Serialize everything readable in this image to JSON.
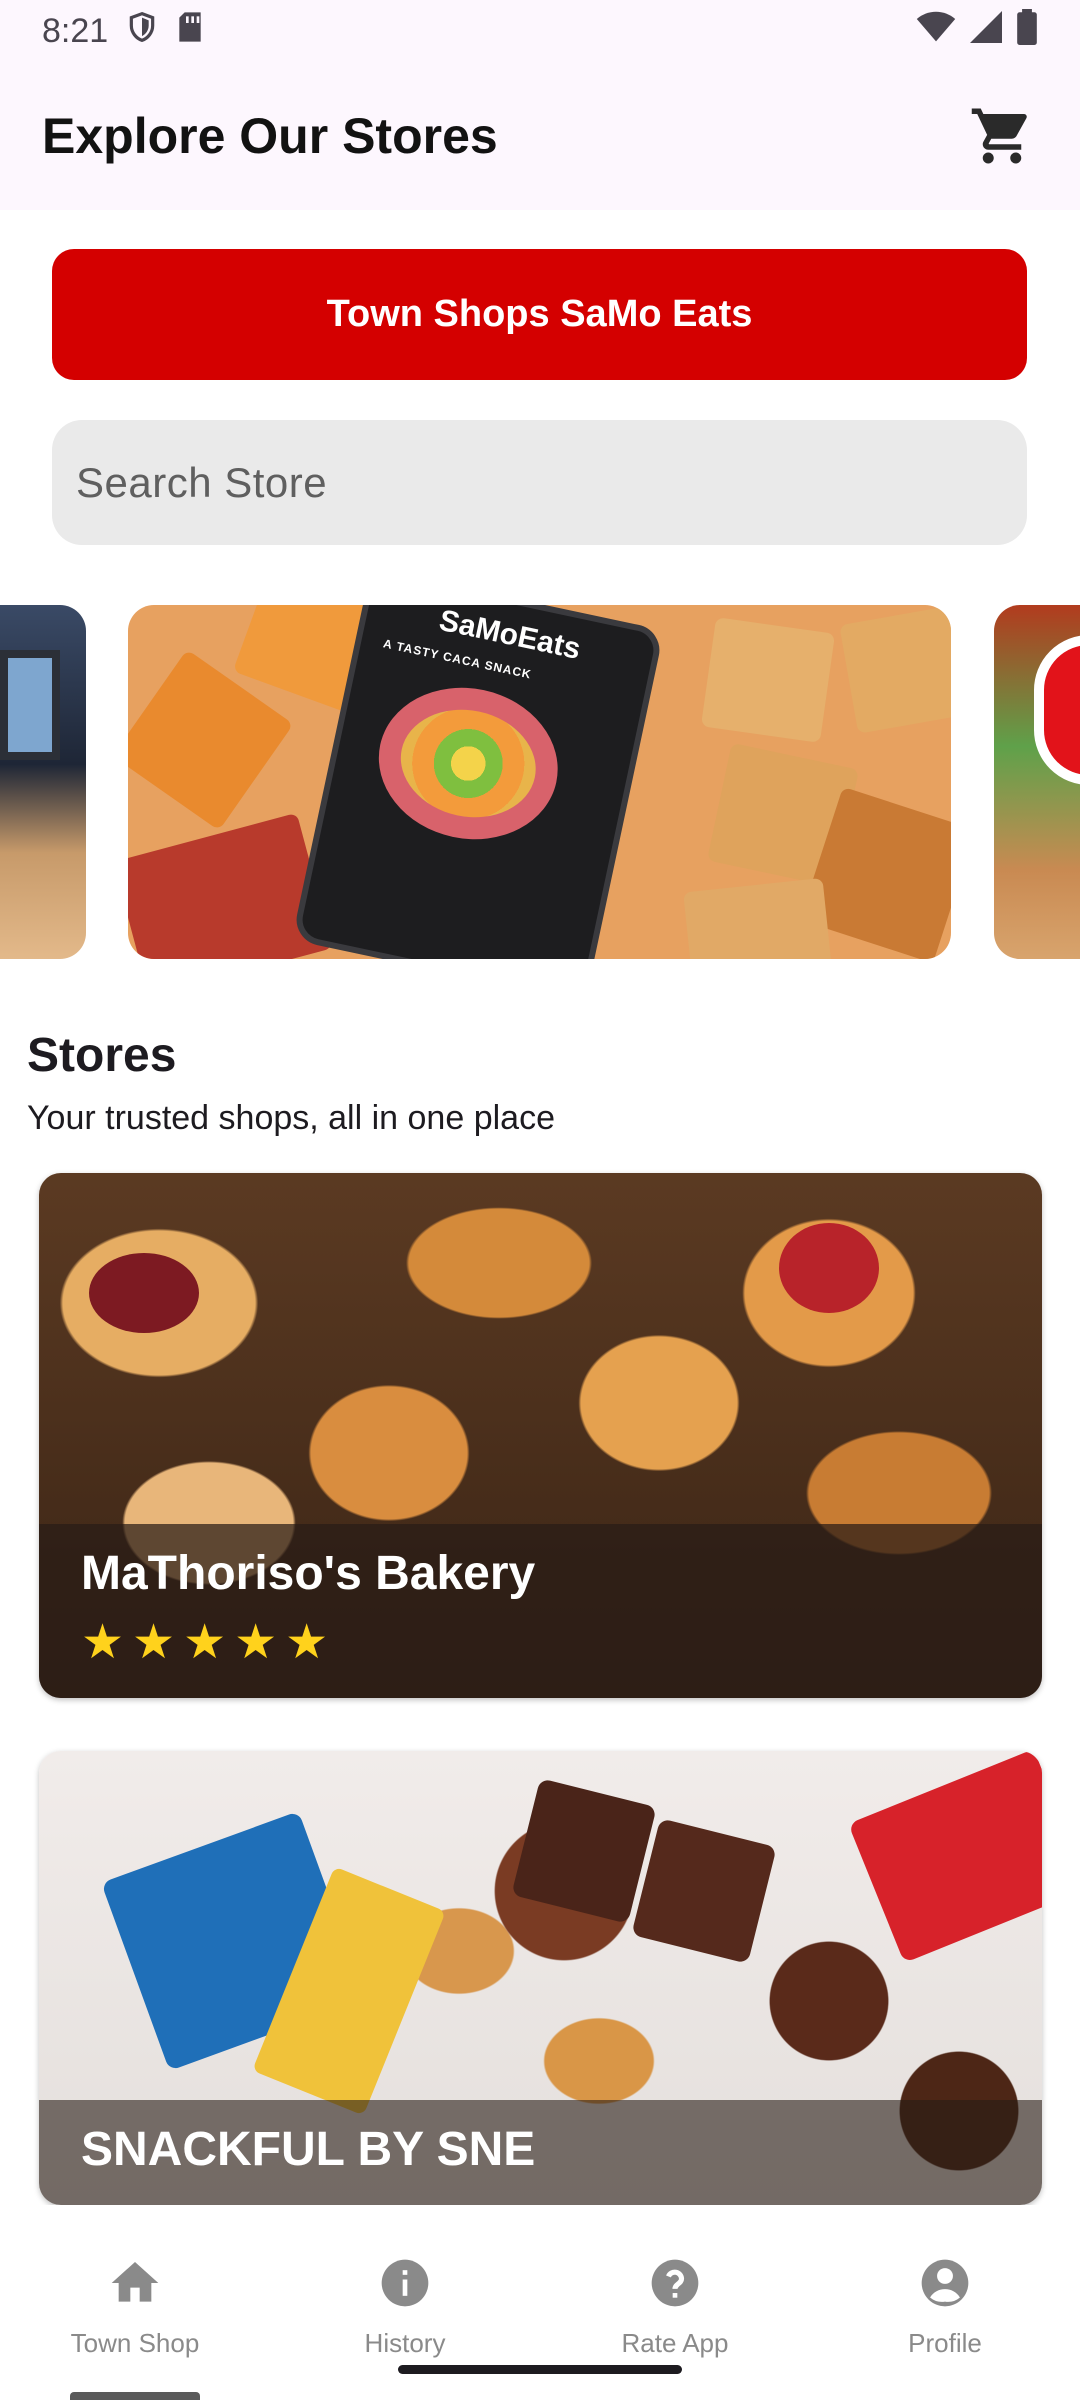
{
  "status_bar": {
    "time": "8:21",
    "icons": [
      "shield-icon",
      "sd-card-icon",
      "wifi-icon",
      "signal-icon",
      "battery-icon"
    ]
  },
  "app_bar": {
    "title": "Explore Our Stores",
    "cart_icon": "cart-icon"
  },
  "brand_button": {
    "label": "Town Shops SaMo Eats"
  },
  "search": {
    "placeholder": "Search Store",
    "value": ""
  },
  "carousel": {
    "slides": [
      {
        "name": "prev-slide"
      },
      {
        "name": "SaMoEats",
        "caption": "A TASTY CACA SNACK"
      },
      {
        "name": "next-slide"
      }
    ]
  },
  "stores_section": {
    "title": "Stores",
    "subtitle": "Your trusted shops, all in one place"
  },
  "stores": [
    {
      "name": "MaThoriso's Bakery",
      "rating": 5
    },
    {
      "name": "SNACKFUL BY SNE"
    }
  ],
  "bottom_nav": {
    "items": [
      {
        "label": "Town Shop",
        "icon": "home-icon"
      },
      {
        "label": "History",
        "icon": "info-icon"
      },
      {
        "label": "Rate App",
        "icon": "help-icon"
      },
      {
        "label": "Profile",
        "icon": "account-icon"
      }
    ]
  },
  "colors": {
    "brand_red": "#d40000",
    "header_bg": "#fdf7fe",
    "star": "#ffd21c",
    "nav_inactive": "#8a8a8a"
  }
}
